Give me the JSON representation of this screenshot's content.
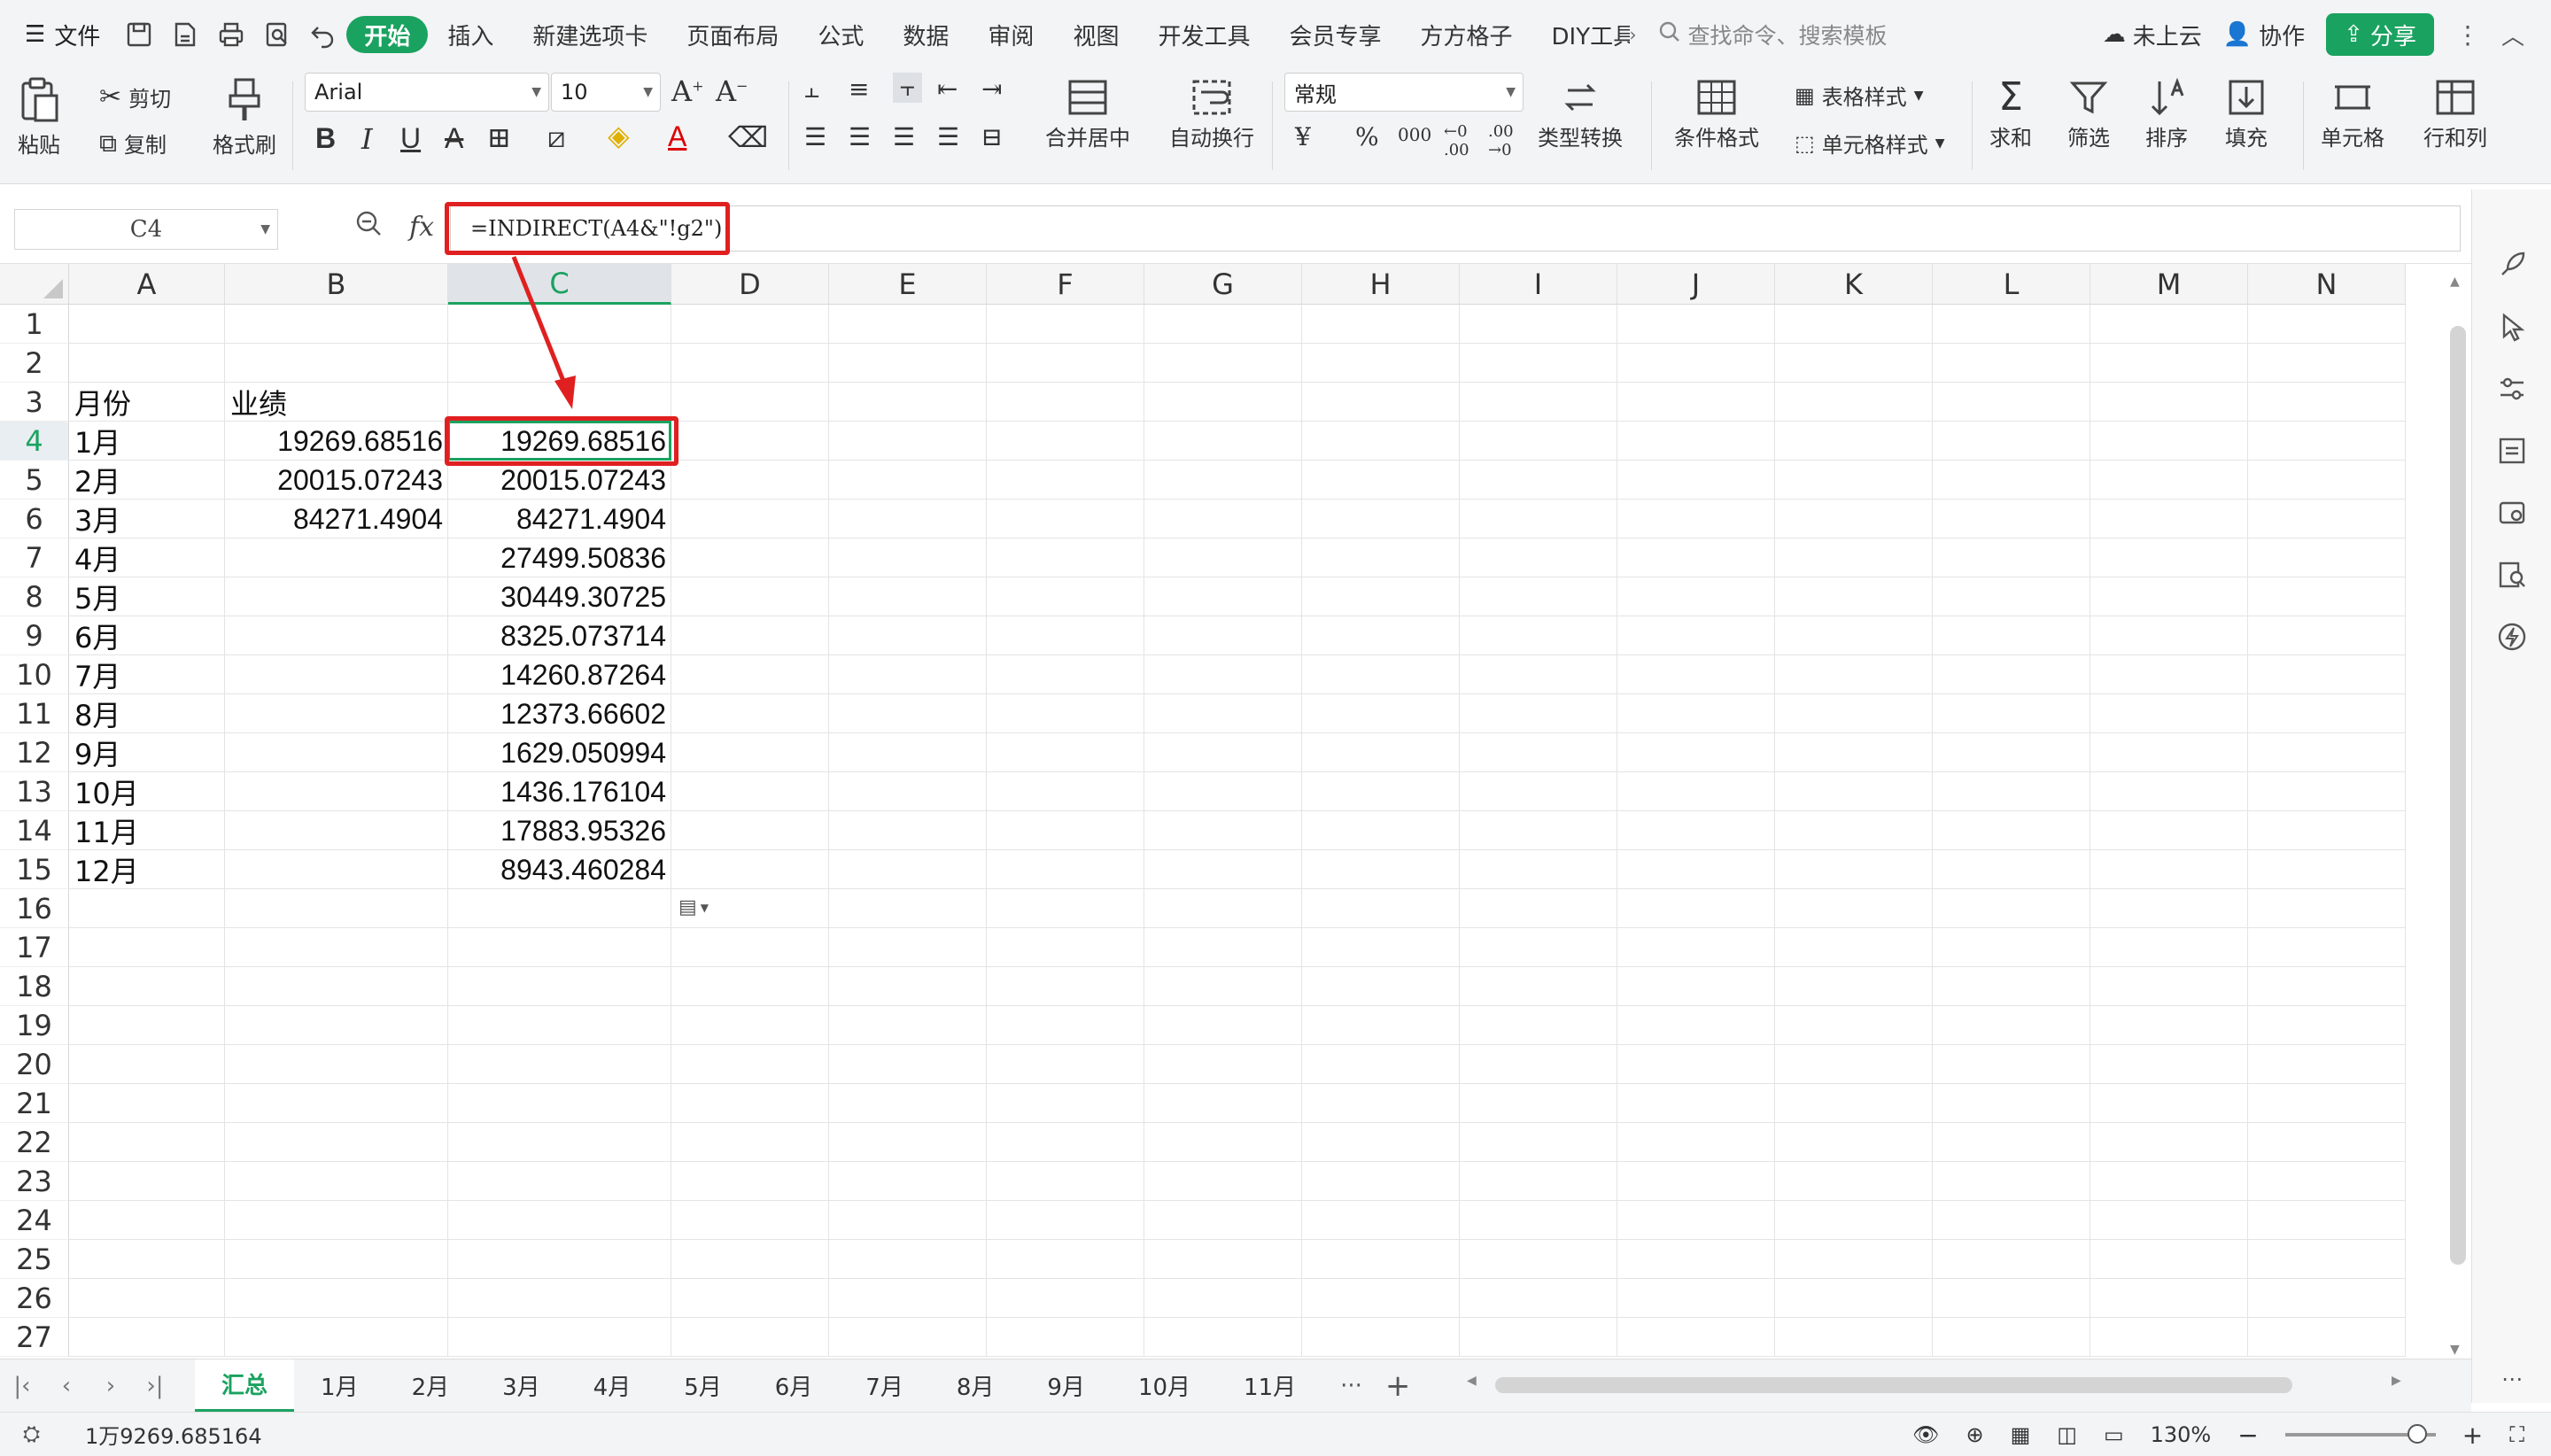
{
  "menubar": {
    "file_label": "文件",
    "tabs": [
      "开始",
      "插入",
      "新建选项卡",
      "页面布局",
      "公式",
      "数据",
      "审阅",
      "视图",
      "开发工具",
      "会员专享",
      "方方格子",
      "DIY工具"
    ],
    "active_tab": "开始",
    "search_placeholder": "查找命令、搜索模板",
    "cloud_label": "未上云",
    "collab_label": "协作",
    "share_label": "分享"
  },
  "ribbon": {
    "paste": "粘贴",
    "cut": "剪切",
    "copy": "复制",
    "format_painter": "格式刷",
    "font_name": "Arial",
    "font_size": "10",
    "merge_center": "合并居中",
    "wrap_text": "自动换行",
    "number_format": "常规",
    "convert": "类型转换",
    "cond_format": "条件格式",
    "table_style": "表格样式",
    "cell_style": "单元格样式",
    "sum": "求和",
    "filter": "筛选",
    "sort": "排序",
    "fill": "填充",
    "cells": "单元格",
    "row_col": "行和列"
  },
  "formula_bar": {
    "name_box": "C4",
    "fx_label": "fx",
    "formula": "=INDIRECT(A4&\"!g2\")"
  },
  "grid": {
    "columns": [
      "A",
      "B",
      "C",
      "D",
      "E",
      "F",
      "G",
      "H",
      "I",
      "J",
      "K",
      "L",
      "M",
      "N"
    ],
    "selected_column": "C",
    "selected_row": 4,
    "rows": [
      1,
      2,
      3,
      4,
      5,
      6,
      7,
      8,
      9,
      10,
      11,
      12,
      13,
      14,
      15,
      16,
      17,
      18,
      19,
      20,
      21,
      22,
      23,
      24,
      25,
      26,
      27
    ],
    "header_row": {
      "A": "月份",
      "B": "业绩"
    },
    "data": [
      {
        "row": 4,
        "A": "1月",
        "B": "19269.68516",
        "C": "19269.68516"
      },
      {
        "row": 5,
        "A": "2月",
        "B": "20015.07243",
        "C": "20015.07243"
      },
      {
        "row": 6,
        "A": "3月",
        "B": "84271.4904",
        "C": "84271.4904"
      },
      {
        "row": 7,
        "A": "4月",
        "B": "",
        "C": "27499.50836"
      },
      {
        "row": 8,
        "A": "5月",
        "B": "",
        "C": "30449.30725"
      },
      {
        "row": 9,
        "A": "6月",
        "B": "",
        "C": "8325.073714"
      },
      {
        "row": 10,
        "A": "7月",
        "B": "",
        "C": "14260.87264"
      },
      {
        "row": 11,
        "A": "8月",
        "B": "",
        "C": "12373.66602"
      },
      {
        "row": 12,
        "A": "9月",
        "B": "",
        "C": "1629.050994"
      },
      {
        "row": 13,
        "A": "10月",
        "B": "",
        "C": "1436.176104"
      },
      {
        "row": 14,
        "A": "11月",
        "B": "",
        "C": "17883.95326"
      },
      {
        "row": 15,
        "A": "12月",
        "B": "",
        "C": "8943.460284"
      }
    ]
  },
  "sheet_tabs": {
    "tabs": [
      "汇总",
      "1月",
      "2月",
      "3月",
      "4月",
      "5月",
      "6月",
      "7月",
      "8月",
      "9月",
      "10月",
      "11月"
    ],
    "active": "汇总",
    "more": "···",
    "add": "+"
  },
  "status": {
    "sum_text": "1万9269.685164",
    "zoom": "130%"
  },
  "colors": {
    "accent": "#1aa260",
    "annotation_red": "#e02020"
  }
}
